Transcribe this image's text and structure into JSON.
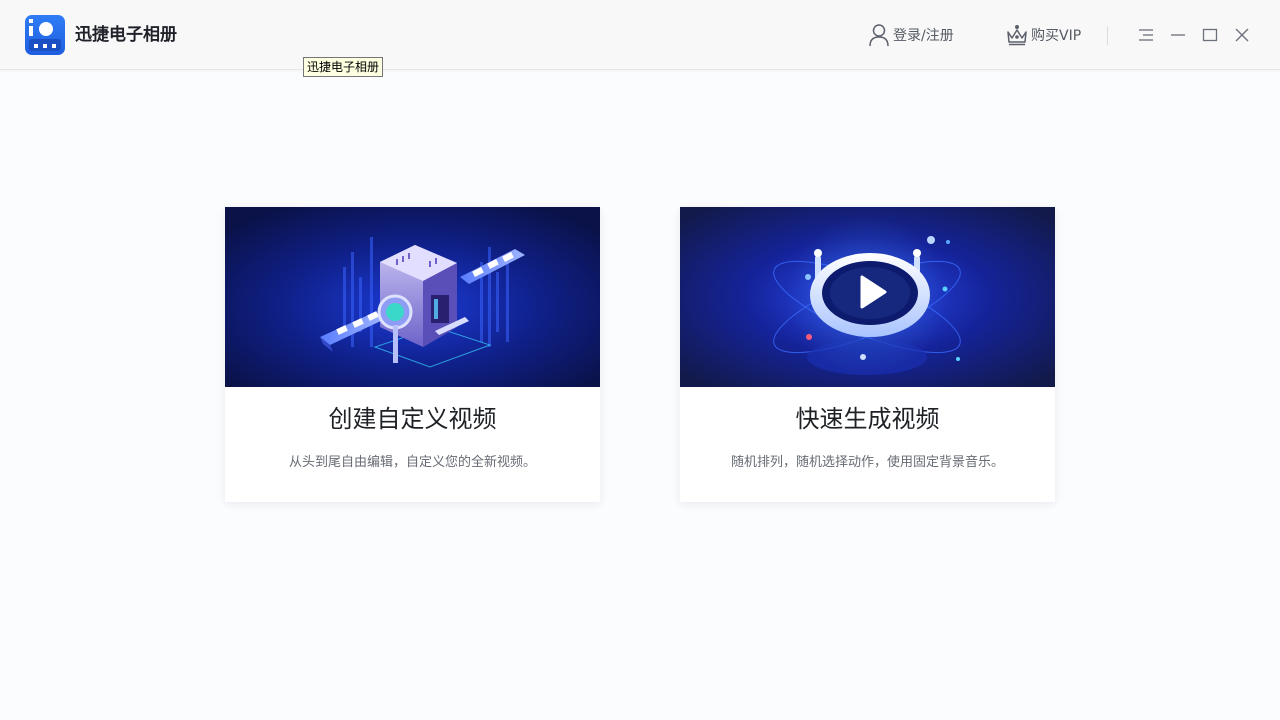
{
  "app": {
    "title": "迅捷电子相册",
    "tooltip": "迅捷电子相册"
  },
  "header": {
    "login_label": "登录/注册",
    "vip_label": "购买VIP",
    "icons": {
      "login": "user-icon",
      "vip": "crown-icon",
      "menu": "menu-icon",
      "minimize": "minimize-icon",
      "maximize": "maximize-icon",
      "close": "close-icon"
    }
  },
  "cards": [
    {
      "title": "创建自定义视频",
      "description": "从头到尾自由编辑，自定义您的全新视频。",
      "illustration": "film-machine-illustration"
    },
    {
      "title": "快速生成视频",
      "description": "随机排列，随机选择动作，使用固定背景音乐。",
      "illustration": "play-button-illustration"
    }
  ],
  "colors": {
    "brand": "#2f7cf6",
    "banner_dark": "#0b1450",
    "banner_mid": "#1a3fd0",
    "titlebar_bg": "#f8f8f9",
    "page_bg": "#fbfcfe"
  }
}
